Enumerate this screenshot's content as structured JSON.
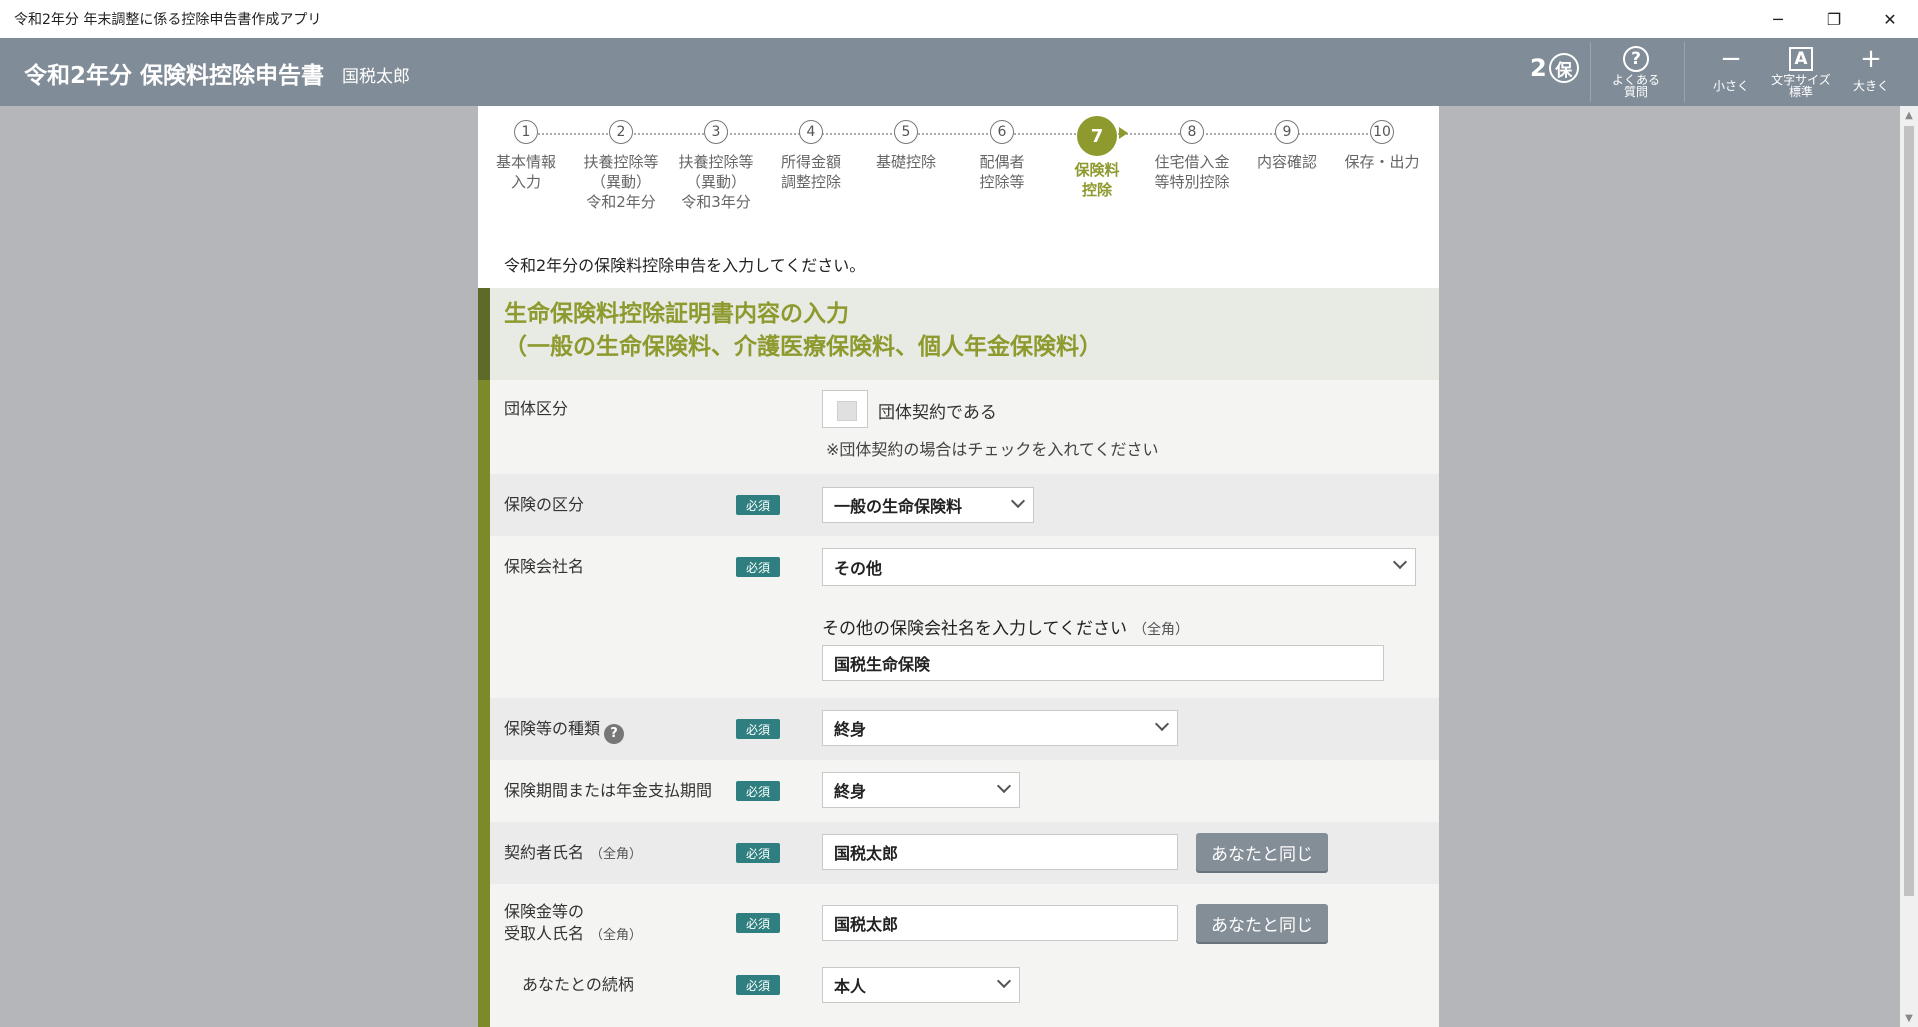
{
  "window": {
    "title": "令和2年分 年末調整に係る控除申告書作成アプリ",
    "minimize": "─",
    "restore": "❐",
    "close": "✕"
  },
  "header": {
    "title": "令和2年分 保険料控除申告書",
    "user": "国税太郎",
    "badge_num": "2",
    "badge_char": "保",
    "faq": {
      "icon": "?",
      "label1": "よくある",
      "label2": "質問"
    },
    "smaller": {
      "icon": "−",
      "label": "小さく"
    },
    "font_size": {
      "icon": "A",
      "label1": "文字サイズ",
      "label2": "標準"
    },
    "larger": {
      "icon": "+",
      "label": "大きく"
    }
  },
  "steps": [
    {
      "num": "1",
      "l1": "基本情報",
      "l2": "入力",
      "l3": ""
    },
    {
      "num": "2",
      "l1": "扶養控除等",
      "l2": "（異動）",
      "l3": "令和2年分"
    },
    {
      "num": "3",
      "l1": "扶養控除等",
      "l2": "（異動）",
      "l3": "令和3年分"
    },
    {
      "num": "4",
      "l1": "所得金額",
      "l2": "調整控除",
      "l3": ""
    },
    {
      "num": "5",
      "l1": "基礎控除",
      "l2": "",
      "l3": ""
    },
    {
      "num": "6",
      "l1": "配偶者",
      "l2": "控除等",
      "l3": ""
    },
    {
      "num": "7",
      "l1": "保険料",
      "l2": "控除",
      "l3": ""
    },
    {
      "num": "8",
      "l1": "住宅借入金",
      "l2": "等特別控除",
      "l3": ""
    },
    {
      "num": "9",
      "l1": "内容確認",
      "l2": "",
      "l3": ""
    },
    {
      "num": "10",
      "l1": "保存・出力",
      "l2": "",
      "l3": ""
    }
  ],
  "intro": "令和2年分の保険料控除申告を入力してください。",
  "section": {
    "title1": "生命保険料控除証明書内容の入力",
    "title2": "（一般の生命保険料、介護医療保険料、個人年金保険料）"
  },
  "form": {
    "required": "必須",
    "group": {
      "label": "団体区分",
      "checkbox_label": "団体契約である",
      "note": "※団体契約の場合はチェックを入れてください",
      "checked": false
    },
    "insurance_type": {
      "label": "保険の区分",
      "value": "一般の生命保険料"
    },
    "company": {
      "label": "保険会社名",
      "value": "その他",
      "other_label": "その他の保険会社名を入力してください",
      "other_hint": "（全角）",
      "other_value": "国税生命保険"
    },
    "kind": {
      "label": "保険等の種類",
      "help": "?",
      "value": "終身"
    },
    "period": {
      "label": "保険期間または年金支払期間",
      "value": "終身"
    },
    "contractor": {
      "label": "契約者氏名",
      "hint": "（全角）",
      "value": "国税太郎",
      "same_button": "あなたと同じ"
    },
    "recipient": {
      "label1": "保険金等の",
      "label2": "受取人氏名",
      "hint": "（全角）",
      "value": "国税太郎",
      "same_button": "あなたと同じ"
    },
    "relation": {
      "label": "あなたとの続柄",
      "value": "本人"
    }
  },
  "scroll": {
    "up": "▲",
    "down": "▼"
  }
}
